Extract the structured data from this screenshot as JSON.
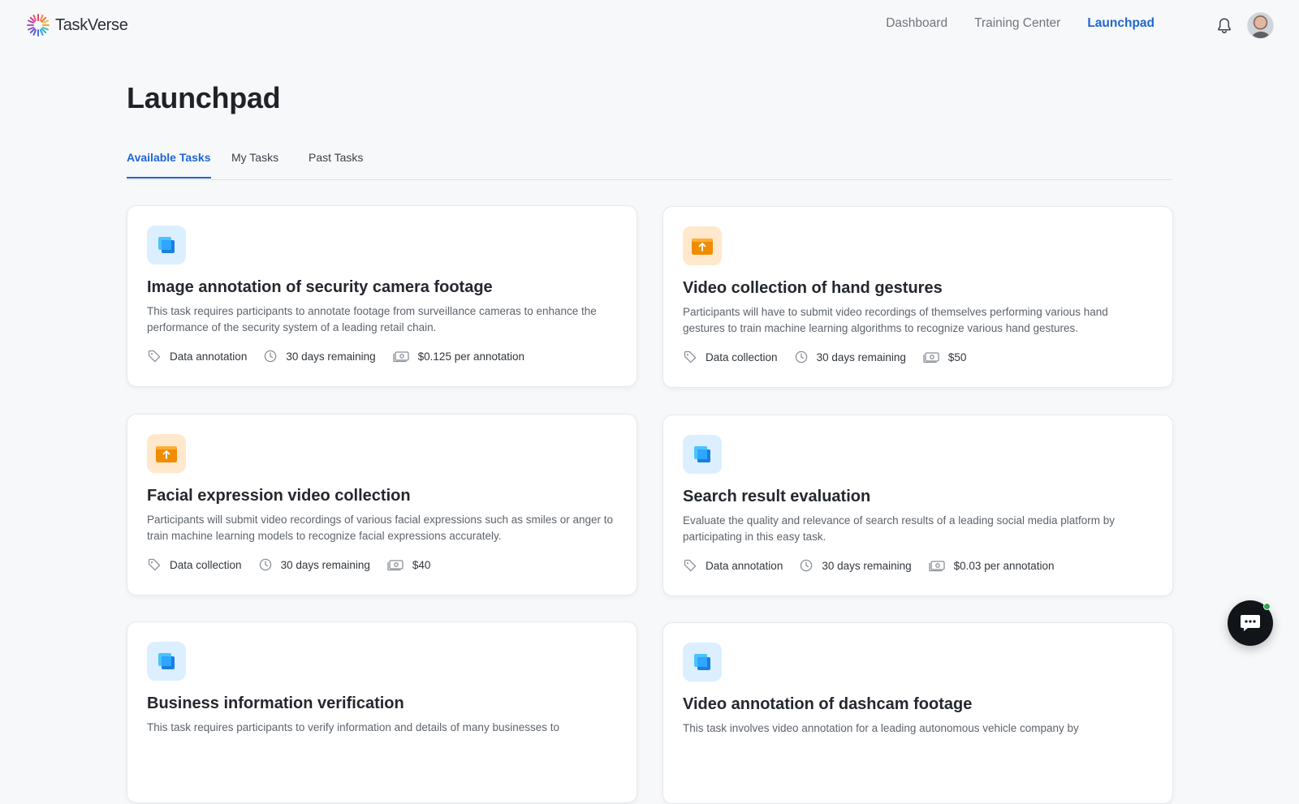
{
  "app": {
    "name": "TaskVerse",
    "logo_icon": "starburst-logo-icon"
  },
  "nav": {
    "items": [
      {
        "label": "Dashboard",
        "active": false
      },
      {
        "label": "Training Center",
        "active": false
      },
      {
        "label": "Launchpad",
        "active": true
      }
    ],
    "notifications_icon": "bell-icon",
    "avatar": "user-avatar"
  },
  "page": {
    "title": "Launchpad"
  },
  "tabs": [
    {
      "label": "Available Tasks",
      "active": true
    },
    {
      "label": "My Tasks",
      "active": false
    },
    {
      "label": "Past Tasks",
      "active": false
    }
  ],
  "tasks": [
    {
      "icon": "layers-icon",
      "icon_color": "#1aa3f2",
      "title": "Image annotation of security camera footage",
      "description": "This task requires participants to annotate footage from surveillance cameras to enhance the performance of the security system of a leading retail chain.",
      "category": "Data annotation",
      "time_left": "30 days remaining",
      "pay": "$0.125 per annotation"
    },
    {
      "icon": "upload-folder-icon",
      "icon_color": "#f08c00",
      "title": "Video collection of hand gestures",
      "description": "Participants will have to submit video recordings of themselves performing various hand gestures to train machine learning algorithms to recognize various hand gestures.",
      "category": "Data collection",
      "time_left": "30 days remaining",
      "pay": "$50"
    },
    {
      "icon": "upload-folder-icon",
      "icon_color": "#f08c00",
      "title": "Facial expression video collection",
      "description": "Participants will submit video recordings of various facial expressions such as smiles or anger to train machine learning models to recognize facial expressions accurately.",
      "category": "Data collection",
      "time_left": "30 days remaining",
      "pay": "$40"
    },
    {
      "icon": "layers-icon",
      "icon_color": "#1aa3f2",
      "title": "Search result evaluation",
      "description": "Evaluate the quality and relevance of search results of a leading social media platform by participating in this easy task.",
      "category": "Data annotation",
      "time_left": "30 days remaining",
      "pay": "$0.03 per annotation"
    },
    {
      "icon": "layers-icon",
      "icon_color": "#1aa3f2",
      "title": "Business information verification",
      "description": "This task requires participants to verify information and details of many businesses to",
      "category": "",
      "time_left": "",
      "pay": ""
    },
    {
      "icon": "layers-icon",
      "icon_color": "#1aa3f2",
      "title": "Video annotation of dashcam footage",
      "description": "This task involves video annotation for a leading autonomous vehicle company by",
      "category": "",
      "time_left": "",
      "pay": ""
    }
  ],
  "chat": {
    "icon": "chat-bubble-icon",
    "online_indicator": "#2ea44f"
  }
}
